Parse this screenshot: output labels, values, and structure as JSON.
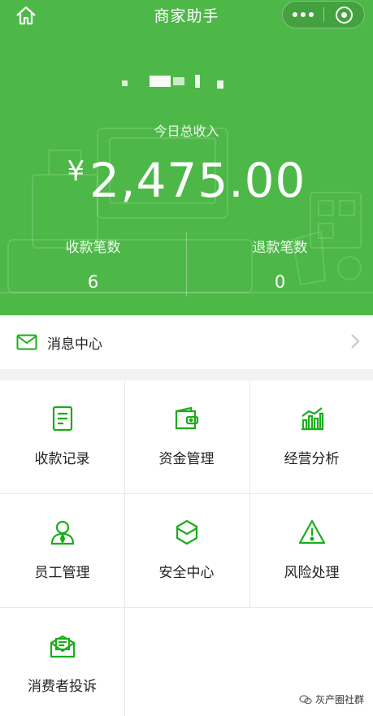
{
  "nav": {
    "title": "商家助手",
    "home_icon": "home-icon",
    "more_icon": "more-dots-icon",
    "close_icon": "close-target-icon"
  },
  "header": {
    "income_label": "今日总收入",
    "currency": "¥",
    "income_value": "2,475.00",
    "stats": [
      {
        "label": "收款笔数",
        "value": "6"
      },
      {
        "label": "退款笔数",
        "value": "0"
      }
    ]
  },
  "message": {
    "label": "消息中心",
    "icon": "envelope-icon"
  },
  "grid": {
    "items": [
      {
        "label": "收款记录",
        "icon": "receipt-icon"
      },
      {
        "label": "资金管理",
        "icon": "wallet-icon"
      },
      {
        "label": "经营分析",
        "icon": "bar-chart-icon"
      },
      {
        "label": "员工管理",
        "icon": "staff-icon"
      },
      {
        "label": "安全中心",
        "icon": "shield-icon"
      },
      {
        "label": "风险处理",
        "icon": "warning-icon"
      },
      {
        "label": "消费者投诉",
        "icon": "complaint-mail-icon"
      }
    ]
  },
  "colors": {
    "brand_green": "#4db848",
    "icon_green": "#1aad19"
  },
  "watermark": {
    "text": "灰产圈社群"
  }
}
